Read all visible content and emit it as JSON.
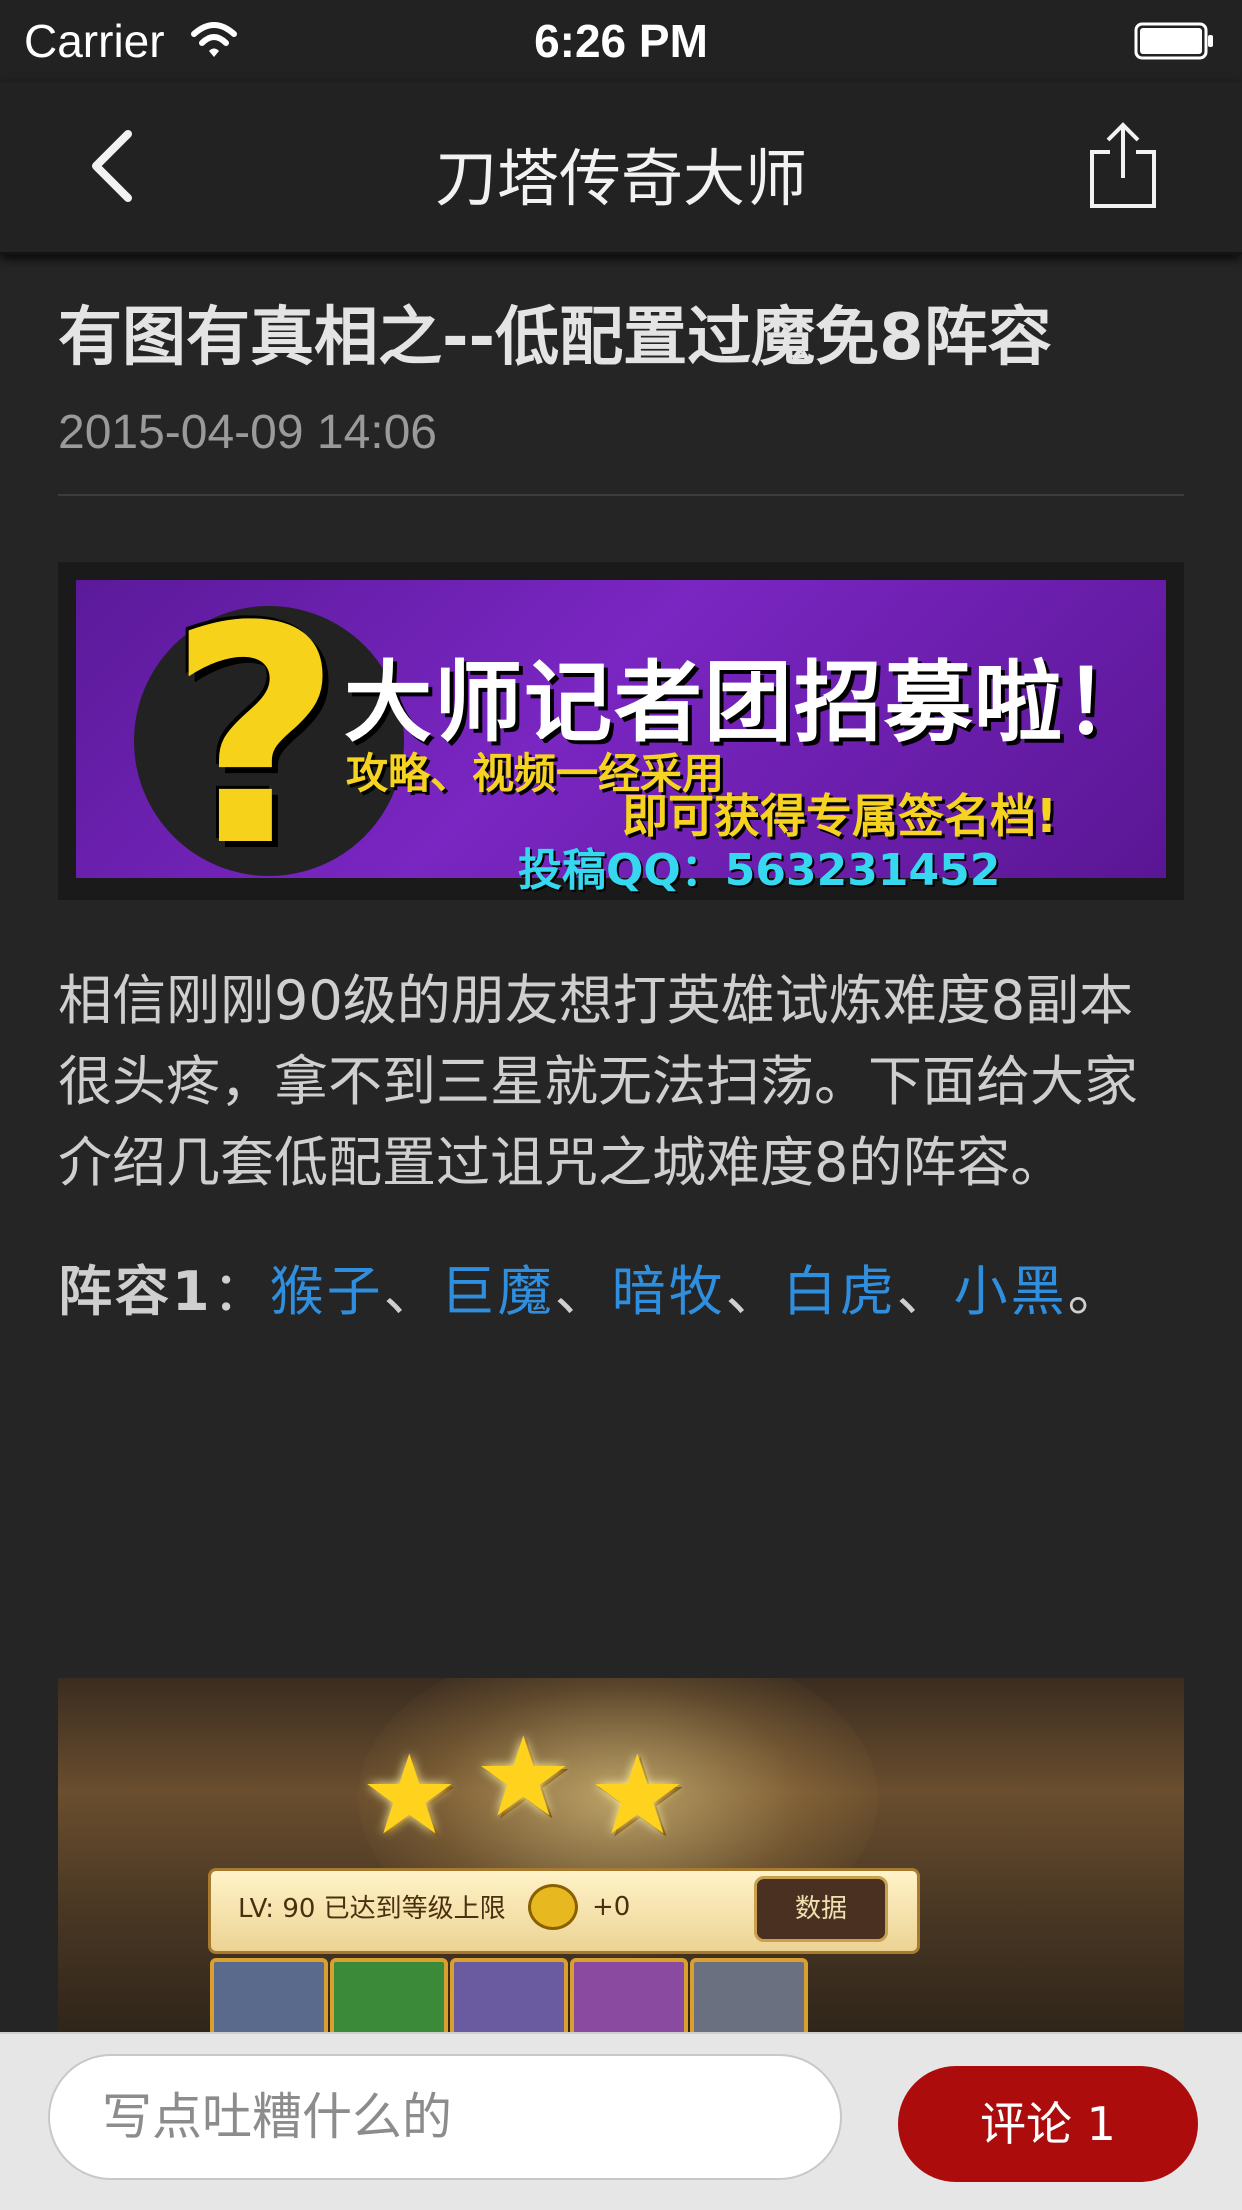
{
  "status_bar": {
    "carrier": "Carrier",
    "time": "6:26 PM"
  },
  "nav": {
    "title": "刀塔传奇大师",
    "back_icon": "chevron-left-icon",
    "share_icon": "share-icon"
  },
  "article": {
    "title": "有图有真相之--低配置过魔免8阵容",
    "date": "2015-04-09 14:06",
    "banner": {
      "headline": "大师记者团招募啦！",
      "line1": "攻略、视频一经采用",
      "line2": "即可获得专属签名档!",
      "contact": "投稿QQ：563231452"
    },
    "paragraph1": "相信刚刚90级的朋友想打英雄试炼难度8副本很头疼，拿不到三星就无法扫荡。下面给大家介绍几套低配置过诅咒之城难度8的阵容。",
    "lineup1": {
      "label": "阵容1",
      "colon": "：",
      "heroes": [
        "猴子",
        "巨魔",
        "暗牧",
        "白虎",
        "小黑"
      ],
      "separator": "、",
      "end": "。"
    },
    "game_image": {
      "level_text": "LV: 90  已达到等级上限",
      "coins": "+0",
      "data_button": "数据"
    }
  },
  "bottom_bar": {
    "placeholder": "写点吐糟什么的",
    "comment_button": "评论 1"
  },
  "colors": {
    "background": "#252525",
    "link": "#2f8fde",
    "comment_button": "#ac0c0c"
  }
}
